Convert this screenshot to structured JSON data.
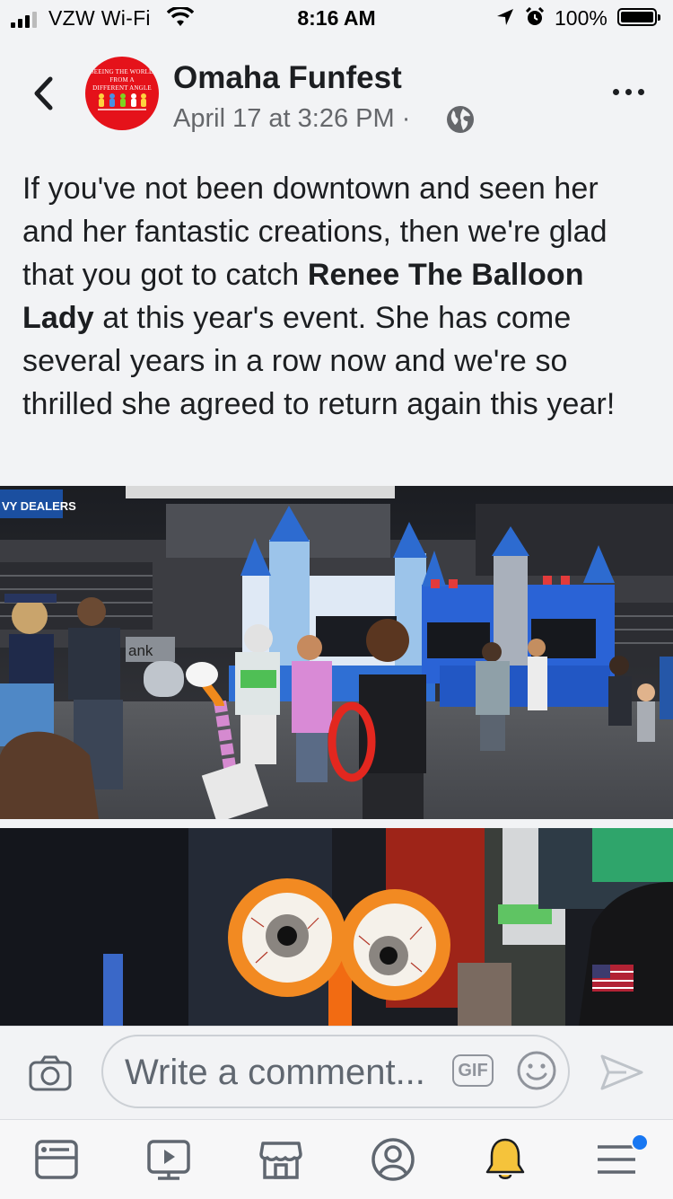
{
  "status_bar": {
    "carrier": "VZW Wi-Fi",
    "time": "8:16 AM",
    "battery": "100%"
  },
  "post": {
    "page_name": "Omaha Funfest",
    "avatar_text": [
      "SEEING THE WORLD",
      "FROM A",
      "DIFFERENT ANGLE"
    ],
    "timestamp": "April 17 at 3:26 PM",
    "separator": "·",
    "text_parts": [
      "If you've not been downtown and seen her and her fantastic creations, then we're glad that you got to catch ",
      "Renee The Balloon Lady",
      " at this year's event. She has come several years in a row now and we're so thrilled she agreed to return again this year!"
    ],
    "photo1_text": {
      "banner": "VY DEALERS",
      "sign": "ank"
    }
  },
  "comment_bar": {
    "placeholder": "Write a comment...",
    "gif_label": "GIF"
  },
  "tab_bar": {
    "tabs": [
      "news-feed",
      "watch",
      "marketplace",
      "profile",
      "notifications",
      "menu"
    ],
    "active_color": "#f5c33b",
    "dot_color": "#1877f2"
  },
  "colors": {
    "accent": "#1877f2",
    "avatar_red": "#e5121a"
  }
}
